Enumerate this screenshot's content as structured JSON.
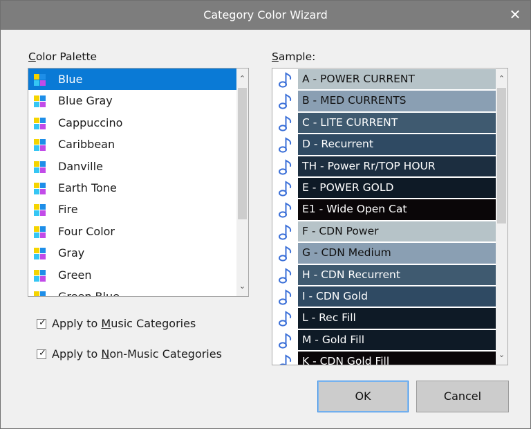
{
  "window": {
    "title": "Category Color Wizard",
    "close_glyph": "✕"
  },
  "palette": {
    "label_accel": "C",
    "label_rest": "olor Palette",
    "selected_index": 0,
    "items": [
      "Blue",
      "Blue Gray",
      "Cappuccino",
      "Caribbean",
      "Danville",
      "Earth Tone",
      "Fire",
      "Four Color",
      "Gray",
      "Green",
      "Green Blue"
    ]
  },
  "sample": {
    "label_accel": "S",
    "label_rest": "ample:",
    "items": [
      {
        "label": "A - POWER CURRENT",
        "bg": "#b6c3c8",
        "fg": "#111111"
      },
      {
        "label": "B - MED CURRENTS",
        "bg": "#8a9fb3",
        "fg": "#111111"
      },
      {
        "label": "C - LITE CURRENT",
        "bg": "#3f5a70",
        "fg": "#ffffff"
      },
      {
        "label": "D - Recurrent",
        "bg": "#2f4a63",
        "fg": "#ffffff"
      },
      {
        "label": "TH - Power Rr/TOP HOUR",
        "bg": "#1c2e40",
        "fg": "#ffffff"
      },
      {
        "label": "E - POWER GOLD",
        "bg": "#0e1a26",
        "fg": "#ffffff"
      },
      {
        "label": "E1 - Wide Open Cat",
        "bg": "#0a0608",
        "fg": "#ffffff"
      },
      {
        "label": "F - CDN Power",
        "bg": "#b6c3c8",
        "fg": "#111111"
      },
      {
        "label": "G - CDN Medium",
        "bg": "#8a9fb3",
        "fg": "#111111"
      },
      {
        "label": "H - CDN Recurrent",
        "bg": "#3f5a70",
        "fg": "#ffffff"
      },
      {
        "label": "I - CDN Gold",
        "bg": "#2f4a63",
        "fg": "#ffffff"
      },
      {
        "label": "L - Rec Fill",
        "bg": "#0e1a26",
        "fg": "#ffffff"
      },
      {
        "label": "M - Gold Fill",
        "bg": "#0e1a26",
        "fg": "#ffffff"
      },
      {
        "label": "K - CDN Gold Fill",
        "bg": "#0a0608",
        "fg": "#ffffff"
      }
    ]
  },
  "options": {
    "music": {
      "pre": "Apply to ",
      "accel": "M",
      "post": "usic Categories",
      "checked": true
    },
    "nonmusic": {
      "pre": "Apply to ",
      "accel": "N",
      "post": "on-Music Categories",
      "checked": true
    },
    "check_glyph": "✓"
  },
  "buttons": {
    "ok": "OK",
    "cancel": "Cancel"
  },
  "colors": {
    "selection": "#0a7ad6",
    "icon_yellow": "#f5d400",
    "icon_blue": "#1e8ee8",
    "icon_cyan": "#35c6f4",
    "icon_magenta": "#c24be8",
    "note_blue": "#3a6fd8"
  },
  "icons": {
    "palette_item": "palette-quad-icon",
    "sample_item": "music-note-icon",
    "scroll_up": "chevron-up-icon",
    "scroll_down": "chevron-down-icon"
  },
  "scroll_glyphs": {
    "up": "⌃",
    "down": "⌄"
  }
}
